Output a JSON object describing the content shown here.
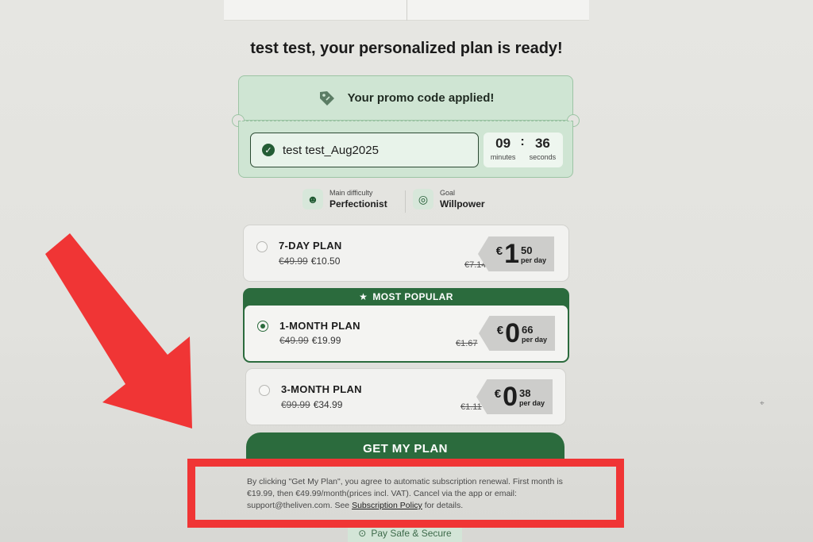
{
  "headline": "test test, your personalized plan is ready!",
  "promo": {
    "title": "Your promo code applied!",
    "code": "test test_Aug2025",
    "timer": {
      "minutes": "09",
      "separator": ":",
      "seconds": "36",
      "minutes_label": "minutes",
      "seconds_label": "seconds"
    }
  },
  "meta": {
    "difficulty_label": "Main difficulty",
    "difficulty_value": "Perfectionist",
    "goal_label": "Goal",
    "goal_value": "Willpower"
  },
  "plans": [
    {
      "name": "7-DAY PLAN",
      "old_price": "€49.99",
      "price": "€10.50",
      "old_per_day": "€7.14",
      "currency": "€",
      "day_int": "1",
      "day_cents": "50",
      "per_day": "per day",
      "selected": false
    },
    {
      "name": "1-MONTH PLAN",
      "old_price": "€49.99",
      "price": "€19.99",
      "old_per_day": "€1.67",
      "currency": "€",
      "day_int": "0",
      "day_cents": "66",
      "per_day": "per day",
      "selected": true
    },
    {
      "name": "3-MONTH PLAN",
      "old_price": "€99.99",
      "price": "€34.99",
      "old_per_day": "€1.11",
      "currency": "€",
      "day_int": "0",
      "day_cents": "38",
      "per_day": "per day",
      "selected": false
    }
  ],
  "popular_label": "MOST POPULAR",
  "cta_label": "GET MY PLAN",
  "legal": {
    "text": "By clicking \"Get My Plan\", you agree to automatic subscription renewal. First month is €19.99, then €49.99/month(prices incl. VAT). Cancel via the app or email: support@theliven.com. See",
    "link": "Subscription Policy",
    "suffix": "for details."
  },
  "pay_safe": "Pay Safe & Secure",
  "colors": {
    "brand_green": "#2b6b3d",
    "promo_bg": "#cfe5d3",
    "highlight_red": "#f03535"
  }
}
